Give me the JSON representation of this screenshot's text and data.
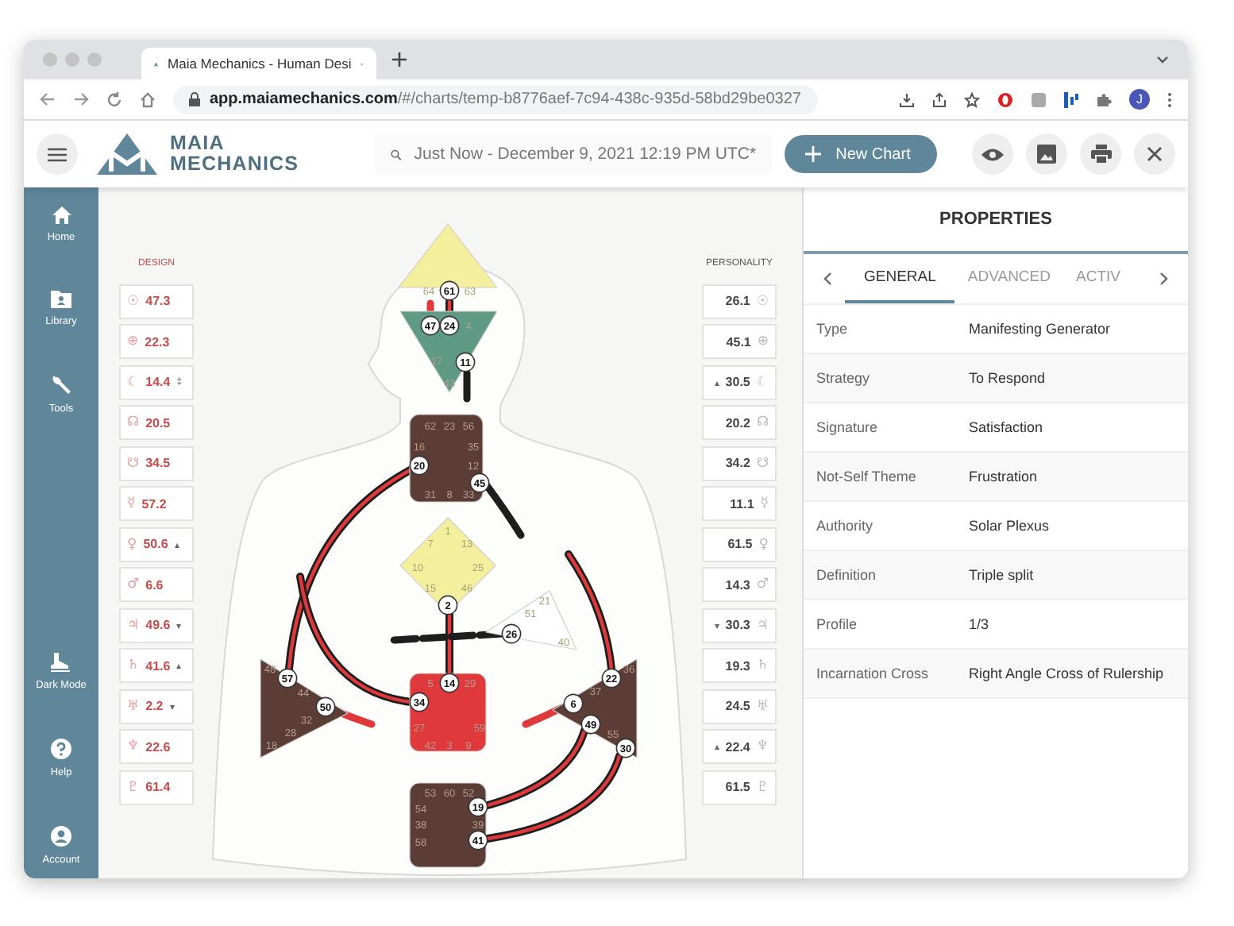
{
  "browser": {
    "tab_title": "Maia Mechanics - Human Desi",
    "url_host": "app.maiamechanics.com",
    "url_path": "/#/charts/temp-b8776aef-7c94-438c-935d-58bd29be0327",
    "profile_initial": "J"
  },
  "app": {
    "logo_line1": "MAIA",
    "logo_line2": "MECHANICS",
    "search": "Just Now - December 9, 2021 12:19 PM UTC*",
    "new_chart": "New Chart"
  },
  "sidebar": [
    {
      "kind": "home",
      "label": "Home"
    },
    {
      "kind": "library",
      "label": "Library"
    },
    {
      "kind": "tools",
      "label": "Tools"
    },
    {
      "kind": "dark",
      "label": "Dark Mode"
    },
    {
      "kind": "help",
      "label": "Help"
    },
    {
      "kind": "account",
      "label": "Account"
    }
  ],
  "design": {
    "heading": "DESIGN",
    "planets": [
      {
        "symbol": "☉",
        "value": "47.3"
      },
      {
        "symbol": "⊕",
        "value": "22.3"
      },
      {
        "symbol": "☾",
        "value": "14.4",
        "mark": "‡"
      },
      {
        "symbol": "☊",
        "value": "20.5"
      },
      {
        "symbol": "☋",
        "value": "34.5"
      },
      {
        "symbol": "☿",
        "value": "57.2"
      },
      {
        "symbol": "♀",
        "value": "50.6",
        "mark": "▴"
      },
      {
        "symbol": "♂",
        "value": "6.6"
      },
      {
        "symbol": "♃",
        "value": "49.6",
        "mark": "▾"
      },
      {
        "symbol": "♄",
        "value": "41.6",
        "mark": "▴"
      },
      {
        "symbol": "♅",
        "value": "2.2",
        "mark": "▾"
      },
      {
        "symbol": "♆",
        "value": "22.6"
      },
      {
        "symbol": "♇",
        "value": "61.4"
      }
    ]
  },
  "personality": {
    "heading": "PERSONALITY",
    "planets": [
      {
        "symbol": "☉",
        "value": "26.1"
      },
      {
        "symbol": "⊕",
        "value": "45.1"
      },
      {
        "symbol": "☾",
        "value": "30.5",
        "mark": "▴"
      },
      {
        "symbol": "☊",
        "value": "20.2"
      },
      {
        "symbol": "☋",
        "value": "34.2"
      },
      {
        "symbol": "☿",
        "value": "11.1"
      },
      {
        "symbol": "♀",
        "value": "61.5"
      },
      {
        "symbol": "♂",
        "value": "14.3"
      },
      {
        "symbol": "♃",
        "value": "30.3",
        "mark": "▾"
      },
      {
        "symbol": "♄",
        "value": "19.3"
      },
      {
        "symbol": "♅",
        "value": "24.5"
      },
      {
        "symbol": "♆",
        "value": "22.4",
        "mark": "▴"
      },
      {
        "symbol": "♇",
        "value": "61.5"
      }
    ]
  },
  "chart": {
    "centers": [
      {
        "kind": "polygon",
        "color": "#f3ef9c",
        "gates": [
          {
            "label": "64",
            "active": false
          },
          {
            "label": "61",
            "active": true
          },
          {
            "label": "63",
            "active": false
          }
        ]
      },
      {
        "kind": "polygon",
        "color": "#5e9a86",
        "gates": [
          {
            "label": "47",
            "active": true
          },
          {
            "label": "24",
            "active": true
          },
          {
            "label": "4",
            "active": false
          },
          {
            "label": "17",
            "active": false
          },
          {
            "label": "11",
            "active": true
          },
          {
            "label": "43",
            "active": false
          }
        ]
      },
      {
        "kind": "square",
        "color": "#5b3d36",
        "gates": [
          {
            "label": "62",
            "active": false
          },
          {
            "label": "23",
            "active": false
          },
          {
            "label": "56",
            "active": false
          },
          {
            "label": "16",
            "active": false
          },
          {
            "label": "35",
            "active": false
          },
          {
            "label": "20",
            "active": true
          },
          {
            "label": "12",
            "active": false
          },
          {
            "label": "45",
            "active": true
          },
          {
            "label": "31",
            "active": false
          },
          {
            "label": "8",
            "active": false
          },
          {
            "label": "33",
            "active": false
          }
        ]
      },
      {
        "kind": "polygon",
        "color": "#f3ef9c",
        "gates": [
          {
            "label": "1",
            "active": false
          },
          {
            "label": "7",
            "active": false
          },
          {
            "label": "13",
            "active": false
          },
          {
            "label": "10",
            "active": false
          },
          {
            "label": "25",
            "active": false
          },
          {
            "label": "15",
            "active": false
          },
          {
            "label": "46",
            "active": false
          },
          {
            "label": "2",
            "active": true
          }
        ]
      },
      {
        "kind": "polygon",
        "color": "#ffffff",
        "gates": [
          {
            "label": "21",
            "active": false
          },
          {
            "label": "51",
            "active": false
          },
          {
            "label": "26",
            "active": true
          },
          {
            "label": "40",
            "active": false
          }
        ]
      },
      {
        "kind": "polygon",
        "color": "#5b3d36",
        "gates": [
          {
            "label": "48",
            "active": false
          },
          {
            "label": "57",
            "active": true
          },
          {
            "label": "44",
            "active": false
          },
          {
            "label": "50",
            "active": true
          },
          {
            "label": "32",
            "active": false
          },
          {
            "label": "28",
            "active": false
          },
          {
            "label": "18",
            "active": false
          }
        ]
      },
      {
        "kind": "square",
        "color": "#e0393b",
        "gates": [
          {
            "label": "5",
            "active": false
          },
          {
            "label": "14",
            "active": true
          },
          {
            "label": "29",
            "active": false
          },
          {
            "label": "34",
            "active": true
          },
          {
            "label": "27",
            "active": false
          },
          {
            "label": "59",
            "active": false
          },
          {
            "label": "42",
            "active": false
          },
          {
            "label": "3",
            "active": false
          },
          {
            "label": "9",
            "active": false
          }
        ]
      },
      {
        "kind": "polygon",
        "color": "#5b3d36",
        "gates": [
          {
            "label": "36",
            "active": false
          },
          {
            "label": "22",
            "active": true
          },
          {
            "label": "37",
            "active": false
          },
          {
            "label": "6",
            "active": true
          },
          {
            "label": "49",
            "active": true
          },
          {
            "label": "55",
            "active": false
          },
          {
            "label": "30",
            "active": true
          }
        ]
      },
      {
        "kind": "square",
        "color": "#5b3d36",
        "gates": [
          {
            "label": "53",
            "active": false
          },
          {
            "label": "60",
            "active": false
          },
          {
            "label": "52",
            "active": false
          },
          {
            "label": "54",
            "active": false
          },
          {
            "label": "19",
            "active": true
          },
          {
            "label": "38",
            "active": false
          },
          {
            "label": "39",
            "active": false
          },
          {
            "label": "58",
            "active": false
          },
          {
            "label": "41",
            "active": true
          }
        ]
      }
    ],
    "channels": [
      {
        "kind": "both"
      },
      {
        "kind": "design"
      },
      {
        "kind": "personality"
      },
      {
        "kind": "both"
      },
      {
        "kind": "both"
      },
      {
        "kind": "personality"
      },
      {
        "kind": "both"
      },
      {
        "kind": "both"
      },
      {
        "kind": "personality"
      },
      {
        "kind": "design"
      },
      {
        "kind": "design"
      },
      {
        "kind": "both"
      },
      {
        "kind": "both"
      }
    ]
  },
  "properties": {
    "title": "PROPERTIES",
    "tabs": [
      {
        "label": "GENERAL",
        "selected": true
      },
      {
        "label": "ADVANCED",
        "selected": false
      },
      {
        "label": "ACTIV",
        "selected": false
      }
    ],
    "rows": [
      {
        "label": "Type",
        "value": "Manifesting Generator"
      },
      {
        "label": "Strategy",
        "value": "To Respond"
      },
      {
        "label": "Signature",
        "value": "Satisfaction"
      },
      {
        "label": "Not-Self Theme",
        "value": "Frustration"
      },
      {
        "label": "Authority",
        "value": "Solar Plexus"
      },
      {
        "label": "Definition",
        "value": "Triple split"
      },
      {
        "label": "Profile",
        "value": "1/3"
      },
      {
        "label": "Incarnation Cross",
        "value": "Right Angle Cross of Rulership"
      }
    ]
  }
}
